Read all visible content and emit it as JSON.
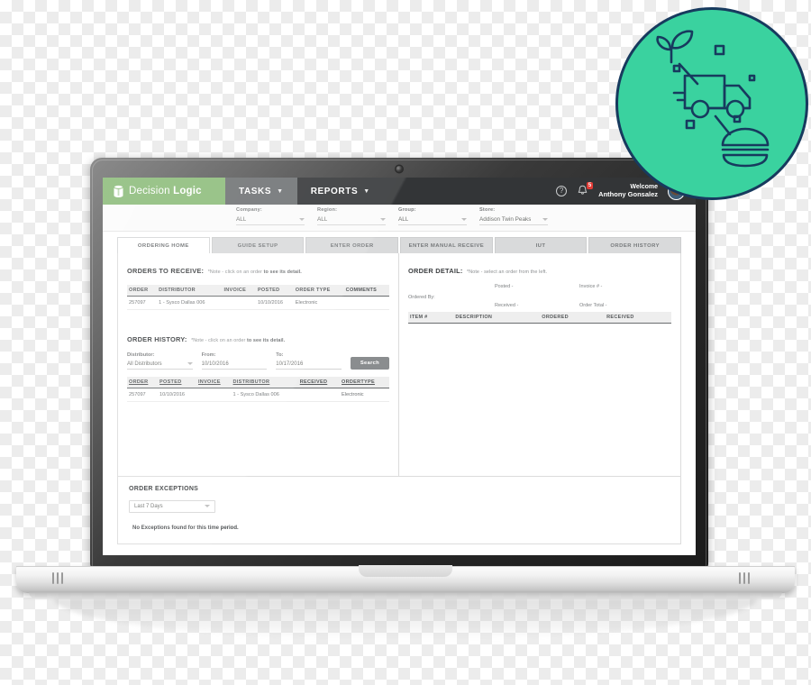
{
  "app": {
    "logo": {
      "name_light": "Decision",
      "name_bold": "Logic",
      "icon": "database-cylinder-icon"
    },
    "nav": [
      {
        "label": "TASKS",
        "caret": "▼",
        "active": true
      },
      {
        "label": "REPORTS",
        "caret": "▼",
        "active": false
      }
    ],
    "header_icons": {
      "help": "?",
      "help_name": "help-icon",
      "bell_name": "notification-bell-icon",
      "notification_count": "5"
    },
    "user": {
      "greeting": "Welcome",
      "name": "Anthony Gonsalez"
    }
  },
  "filters": [
    {
      "label": "Company:",
      "value": "ALL"
    },
    {
      "label": "Region:",
      "value": "ALL"
    },
    {
      "label": "Group:",
      "value": "ALL"
    },
    {
      "label": "Store:",
      "value": "Addison Twin Peaks"
    }
  ],
  "tabs": [
    {
      "label": "ORDERING HOME",
      "active": true
    },
    {
      "label": "GUIDE SETUP",
      "active": false
    },
    {
      "label": "ENTER ORDER",
      "active": false
    },
    {
      "label": "ENTER MANUAL RECEIVE",
      "active": false
    },
    {
      "label": "IUT",
      "active": false
    },
    {
      "label": "ORDER HISTORY",
      "active": false
    }
  ],
  "orders_to_receive": {
    "title": "ORDERS TO RECEIVE:",
    "note_prefix": "*Note - click on an order ",
    "note_bold": "to see its detail.",
    "columns": [
      "ORDER",
      "DISTRIBUTOR",
      "INVOICE",
      "POSTED",
      "ORDER TYPE",
      "COMMENTS"
    ],
    "rows": [
      {
        "order": "257097",
        "distributor": "1 - Sysco Dallas 006",
        "invoice": "",
        "posted": "10/10/2016",
        "order_type": "Electronic",
        "comments": ""
      }
    ]
  },
  "order_detail": {
    "title": "ORDER DETAIL:",
    "note": "*Note - select an order from the left.",
    "ordered_by_label": "Ordered By:",
    "posted_label": "Posted -",
    "received_label": "Received -",
    "invoice_label": "Invoice # -",
    "total_label": "Order Total -",
    "columns": [
      "ITEM #",
      "DESCRIPTION",
      "ORDERED",
      "RECEIVED"
    ],
    "rows": []
  },
  "order_history": {
    "title": "ORDER HISTORY:",
    "note_prefix": "*Note - click on an order ",
    "note_bold": "to see its detail.",
    "distributor_label": "Distributor:",
    "distributor_value": "All Distributors",
    "from_label": "From:",
    "from_value": "10/10/2016",
    "to_label": "To:",
    "to_value": "10/17/2016",
    "search_button": "Search",
    "columns": [
      "ORDER",
      "POSTED",
      "INVOICE",
      "DISTRIBUTOR",
      "RECEIVED",
      "ORDERTYPE"
    ],
    "rows": [
      {
        "order": "257097",
        "posted": "10/10/2016",
        "invoice": "",
        "distributor": "1 - Sysco Dallas 006",
        "received": "",
        "ordertype": "Electronic"
      }
    ]
  },
  "order_exceptions": {
    "title": "ORDER EXCEPTIONS",
    "range_value": "Last 7 Days",
    "empty_message": "No Exceptions found for this time period."
  },
  "badge": {
    "icons": [
      "delivery-truck-icon",
      "plant-sprout-icon",
      "burger-icon"
    ],
    "background_color": "#3ad29f",
    "stroke_color": "#173a5e"
  },
  "theme": {
    "brand_green": "#8cbc7a",
    "topbar_dark": "#333537",
    "tasks_gray": "#6e7173",
    "badge_red": "#e23b35"
  }
}
